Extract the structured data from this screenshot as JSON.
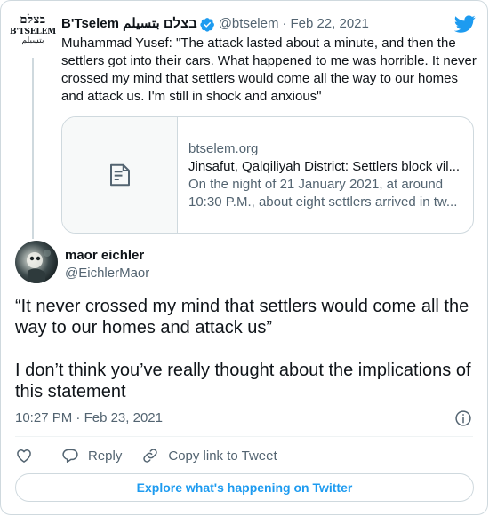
{
  "parent_tweet": {
    "logo": {
      "hebrew": "בצלם",
      "latin": "B'TSELEM",
      "arabic": "بتسيلم"
    },
    "author_name": "B'Tselem בצלם بتسيلم",
    "handle": "@btselem",
    "separator": "·",
    "date": "Feb 22, 2021",
    "text": "Muhammad Yusef: \"The attack lasted about a minute, and then the settlers got into their cars. What happened to me was horrible. It never crossed my mind that settlers would come all the way to our homes and attack us. I'm still in shock and anxious\"",
    "link_card": {
      "domain": "btselem.org",
      "title": "Jinsafut, Qalqiliyah District: Settlers block vil...",
      "description_line1": "On the night of 21 January 2021, at around",
      "description_line2": "10:30 P.M., about eight settlers arrived in tw..."
    }
  },
  "reply_tweet": {
    "author_name": "maor eichler",
    "handle": "@EichlerMaor",
    "text": "“It never crossed my mind that settlers would come all the way to our homes and attack us”\n\nI don’t think you’ve really thought about the implications of this statement",
    "time": "10:27 PM",
    "separator": "·",
    "date": "Feb 23, 2021"
  },
  "actions": {
    "reply_label": "Reply",
    "copy_link_label": "Copy link to Tweet"
  },
  "explore_label": "Explore what's happening on Twitter",
  "icons": {
    "verified": "verified-badge-icon",
    "twitter": "twitter-bird-icon",
    "article": "article-icon",
    "info": "info-icon",
    "like": "heart-icon",
    "reply": "reply-bubble-icon",
    "copy_link": "link-icon"
  },
  "colors": {
    "accent": "#1d9bf0",
    "muted": "#536471",
    "text": "#0f1419",
    "border": "#cfd9de"
  }
}
